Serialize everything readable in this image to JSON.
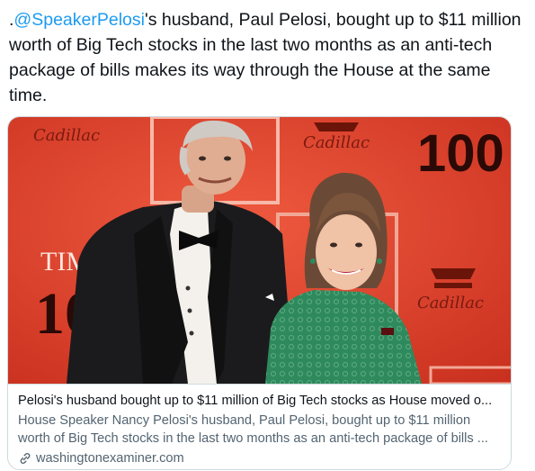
{
  "tweet": {
    "prefix": ".",
    "mention": "@SpeakerPelosi",
    "body": "'s husband, Paul Pelosi, bought up to $11 million worth of Big Tech stocks in the last two months as an anti-tech package of bills makes its way through the House at the same time."
  },
  "photo": {
    "backdrop_logos": [
      "Cadillac",
      "Cadillac",
      "Cadillac"
    ],
    "backdrop_numbers": [
      "100",
      "TIM",
      "10"
    ],
    "colors": {
      "backdrop": "#e8452f",
      "green_dress": "#2e8a5c",
      "tuxedo": "#1b1b1d"
    }
  },
  "card": {
    "title": "Pelosi's husband bought up to $11 million of Big Tech stocks as House moved o...",
    "description_line1": "House Speaker Nancy Pelosi's husband, Paul Pelosi, bought up to $11 million",
    "description_line2": "worth of Big Tech stocks in the last two months as an anti-tech package of bills ...",
    "domain": "washingtonexaminer.com",
    "domain_icon": "link-icon"
  },
  "colors": {
    "mention": "#1d9bf0",
    "text": "#0f1419",
    "secondary": "#536471",
    "border": "#cfd9de"
  }
}
